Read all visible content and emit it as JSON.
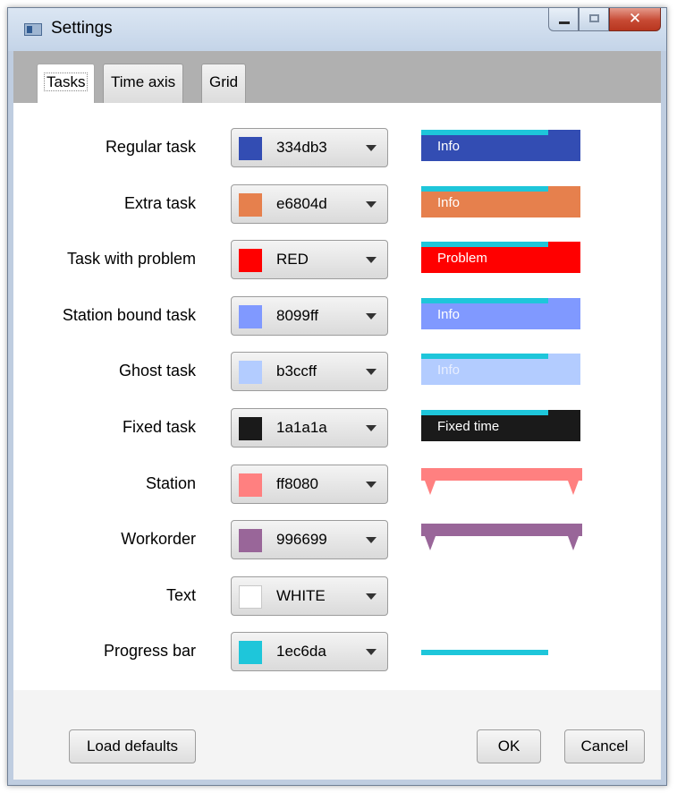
{
  "window": {
    "title": "Settings"
  },
  "tabs": [
    {
      "label": "Tasks",
      "active": true
    },
    {
      "label": "Time axis",
      "active": false
    },
    {
      "label": "Grid",
      "active": false
    }
  ],
  "rows": [
    {
      "label": "Regular task",
      "value": "334db3",
      "color": "#334db3",
      "preview_type": "task",
      "preview_text": "Info"
    },
    {
      "label": "Extra task",
      "value": "e6804d",
      "color": "#e6804d",
      "preview_type": "task",
      "preview_text": "Info"
    },
    {
      "label": "Task with problem",
      "value": "RED",
      "color": "#ff0000",
      "preview_type": "task",
      "preview_text": "Problem"
    },
    {
      "label": "Station bound task",
      "value": "8099ff",
      "color": "#8099ff",
      "preview_type": "task",
      "preview_text": "Info"
    },
    {
      "label": "Ghost task",
      "value": "b3ccff",
      "color": "#b3ccff",
      "preview_type": "task",
      "preview_text": "Info"
    },
    {
      "label": "Fixed task",
      "value": "1a1a1a",
      "color": "#1a1a1a",
      "preview_type": "task",
      "preview_text": "Fixed time"
    },
    {
      "label": "Station",
      "value": "ff8080",
      "color": "#ff8080",
      "preview_type": "bracket"
    },
    {
      "label": "Workorder",
      "value": "996699",
      "color": "#996699",
      "preview_type": "bracket"
    },
    {
      "label": "Text",
      "value": "WHITE",
      "color": "#ffffff",
      "preview_type": "none"
    },
    {
      "label": "Progress bar",
      "value": "1ec6da",
      "color": "#1ec6da",
      "preview_type": "progress"
    }
  ],
  "buttons": {
    "load_defaults": "Load defaults",
    "ok": "OK",
    "cancel": "Cancel"
  },
  "progress_color": "#1ec6da"
}
